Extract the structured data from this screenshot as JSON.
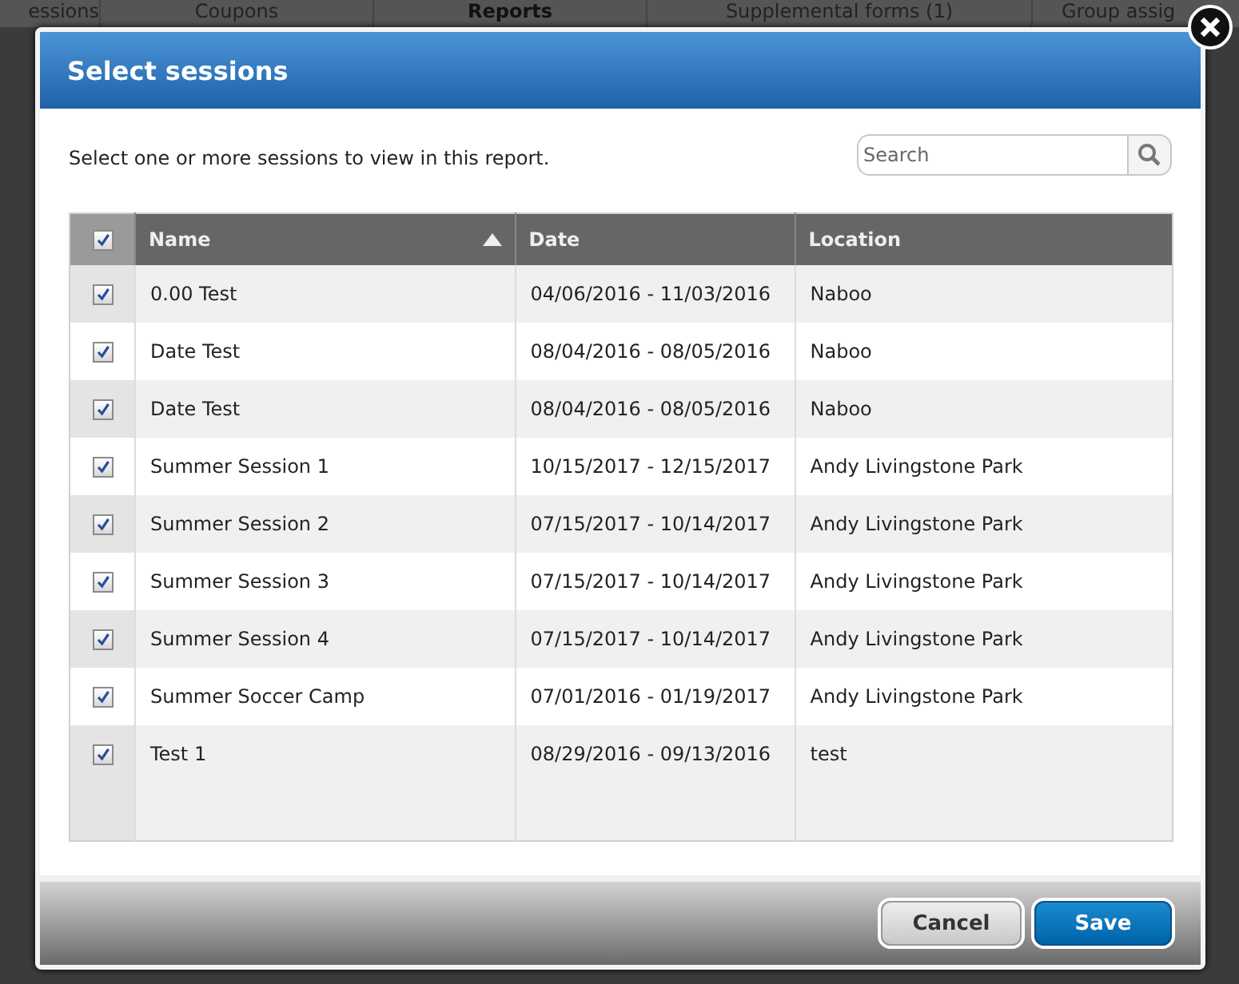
{
  "background_tabs": [
    {
      "label": "essions",
      "selected": false
    },
    {
      "label": "Coupons",
      "selected": false
    },
    {
      "label": "Reports",
      "selected": true
    },
    {
      "label": "Supplemental forms (1)",
      "selected": false
    },
    {
      "label": "Group assig",
      "selected": false
    }
  ],
  "dialog": {
    "title": "Select sessions",
    "instructions": "Select one or more sessions to view in this report.",
    "search": {
      "placeholder": "Search"
    },
    "table": {
      "select_all_checked": true,
      "columns": [
        {
          "label": "Name",
          "sorted": true
        },
        {
          "label": "Date",
          "sorted": false
        },
        {
          "label": "Location",
          "sorted": false
        }
      ],
      "rows": [
        {
          "checked": true,
          "name": "0.00 Test",
          "date": "04/06/2016 - 11/03/2016",
          "location": "Naboo"
        },
        {
          "checked": true,
          "name": "Date Test",
          "date": "08/04/2016 - 08/05/2016",
          "location": "Naboo"
        },
        {
          "checked": true,
          "name": "Date Test",
          "date": "08/04/2016 - 08/05/2016",
          "location": "Naboo"
        },
        {
          "checked": true,
          "name": "Summer Session 1",
          "date": "10/15/2017 - 12/15/2017",
          "location": "Andy Livingstone Park"
        },
        {
          "checked": true,
          "name": "Summer Session 2",
          "date": "07/15/2017 - 10/14/2017",
          "location": "Andy Livingstone Park"
        },
        {
          "checked": true,
          "name": "Summer Session 3",
          "date": "07/15/2017 - 10/14/2017",
          "location": "Andy Livingstone Park"
        },
        {
          "checked": true,
          "name": "Summer Session 4",
          "date": "07/15/2017 - 10/14/2017",
          "location": "Andy Livingstone Park"
        },
        {
          "checked": true,
          "name": "Summer Soccer Camp",
          "date": "07/01/2016 - 01/19/2017",
          "location": "Andy Livingstone Park"
        },
        {
          "checked": true,
          "name": "Test 1",
          "date": "08/29/2016 - 09/13/2016",
          "location": "test"
        }
      ]
    },
    "buttons": [
      {
        "label": "Cancel",
        "kind": "secondary"
      },
      {
        "label": "Save",
        "kind": "primary"
      }
    ]
  }
}
